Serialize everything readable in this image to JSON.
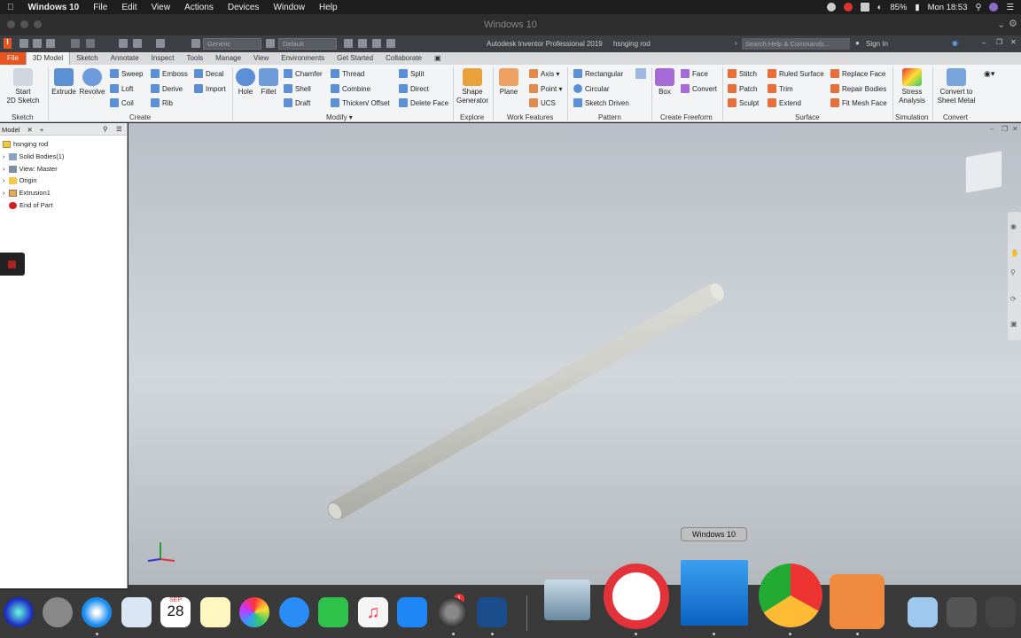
{
  "menubar": {
    "app": "Windows 10",
    "items": [
      "File",
      "Edit",
      "View",
      "Actions",
      "Devices",
      "Window",
      "Help"
    ],
    "battery": "85%",
    "clock": "Mon 18:53"
  },
  "vm_window": {
    "title": "Windows 10"
  },
  "inventor": {
    "title": "Autodesk Inventor Professional 2019",
    "document": "hsnging rod",
    "material": "Generic",
    "appearance": "Default",
    "search_placeholder": "Search Help & Commands...",
    "sign_in": "Sign In"
  },
  "tabs": [
    "File",
    "3D Model",
    "Sketch",
    "Annotate",
    "Inspect",
    "Tools",
    "Manage",
    "View",
    "Environments",
    "Get Started",
    "Collaborate"
  ],
  "ribbon": {
    "sketch": {
      "start": "Start",
      "start2": "2D Sketch",
      "group": "Sketch"
    },
    "create": {
      "extrude": "Extrude",
      "revolve": "Revolve",
      "sweep": "Sweep",
      "loft": "Loft",
      "coil": "Coil",
      "emboss": "Emboss",
      "derive": "Derive",
      "rib": "Rib",
      "decal": "Decal",
      "import": "Import",
      "group": "Create"
    },
    "modify": {
      "hole": "Hole",
      "fillet": "Fillet",
      "chamfer": "Chamfer",
      "shell": "Shell",
      "draft": "Draft",
      "thread": "Thread",
      "combine": "Combine",
      "thicken": "Thicken/ Offset",
      "split": "Split",
      "direct": "Direct",
      "delete_face": "Delete Face",
      "group": "Modify"
    },
    "explore": {
      "shape1": "Shape",
      "shape2": "Generator",
      "group": "Explore"
    },
    "work": {
      "plane": "Plane",
      "axis": "Axis",
      "point": "Point",
      "ucs": "UCS",
      "group": "Work Features"
    },
    "pattern": {
      "rectangular": "Rectangular",
      "circular": "Circular",
      "sketch_driven": "Sketch Driven",
      "group": "Pattern"
    },
    "freeform": {
      "box": "Box",
      "face": "Face",
      "convert": "Convert",
      "group": "Create Freeform"
    },
    "surface": {
      "stitch": "Stitch",
      "patch": "Patch",
      "sculpt": "Sculpt",
      "ruled": "Ruled Surface",
      "trim": "Trim",
      "extend": "Extend",
      "replace": "Replace Face",
      "repair": "Repair Bodies",
      "fitmesh": "Fit Mesh Face",
      "group": "Surface"
    },
    "simulation": {
      "l1": "Stress",
      "l2": "Analysis",
      "group": "Simulation"
    },
    "convert": {
      "l1": "Convert to",
      "l2": "Sheet Metal",
      "group": "Convert"
    }
  },
  "browser": {
    "tab": "Model",
    "root": "hsnging rod",
    "items": [
      "Solid Bodies(1)",
      "View: Master",
      "Origin",
      "Extrusion1",
      "End of Part"
    ]
  },
  "dock": {
    "tooltip": "Windows 10",
    "calendar_month": "SEP",
    "calendar_day": "28",
    "badge": "1"
  },
  "colors": {
    "accent": "#e8541e",
    "viewport_top": "#b8bfc6",
    "rod": "#d9d9d4"
  }
}
